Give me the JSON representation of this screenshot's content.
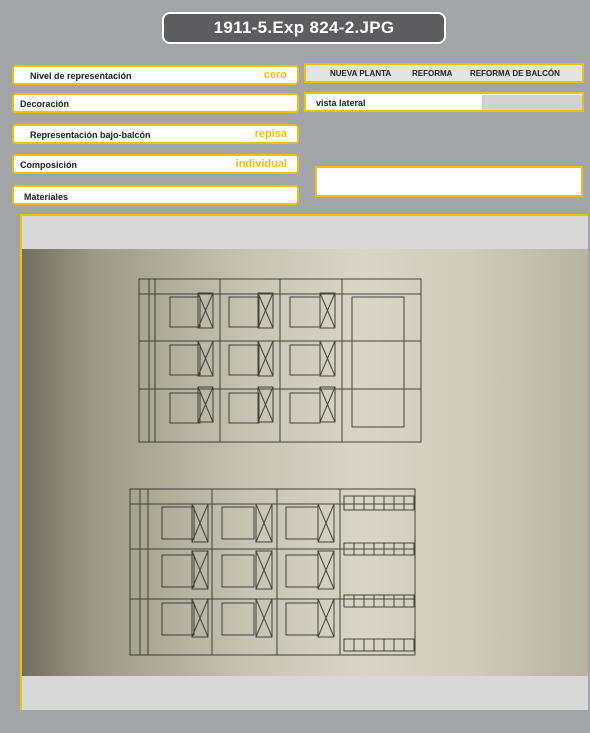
{
  "title": "1911-5.Exp 824-2.JPG",
  "fields": {
    "nivel_label": "Nivel de representación",
    "nivel_value": "cero",
    "decoracion_label": "Decoración",
    "bajo_balcon_label": "Representación bajo-balcón",
    "bajo_balcon_value": "repisa",
    "composicion_label": "Composición",
    "composicion_value": "individual",
    "materiales_label": "Materiales"
  },
  "tabs": [
    "NUEVA PLANTA",
    "REFORMA",
    "REFORMA DE BALCÓN"
  ],
  "view": {
    "label": "vista lateral"
  },
  "colors": {
    "accent": "#f0c010",
    "background": "#a3a4a8",
    "title_bg": "#5d5d5f"
  }
}
